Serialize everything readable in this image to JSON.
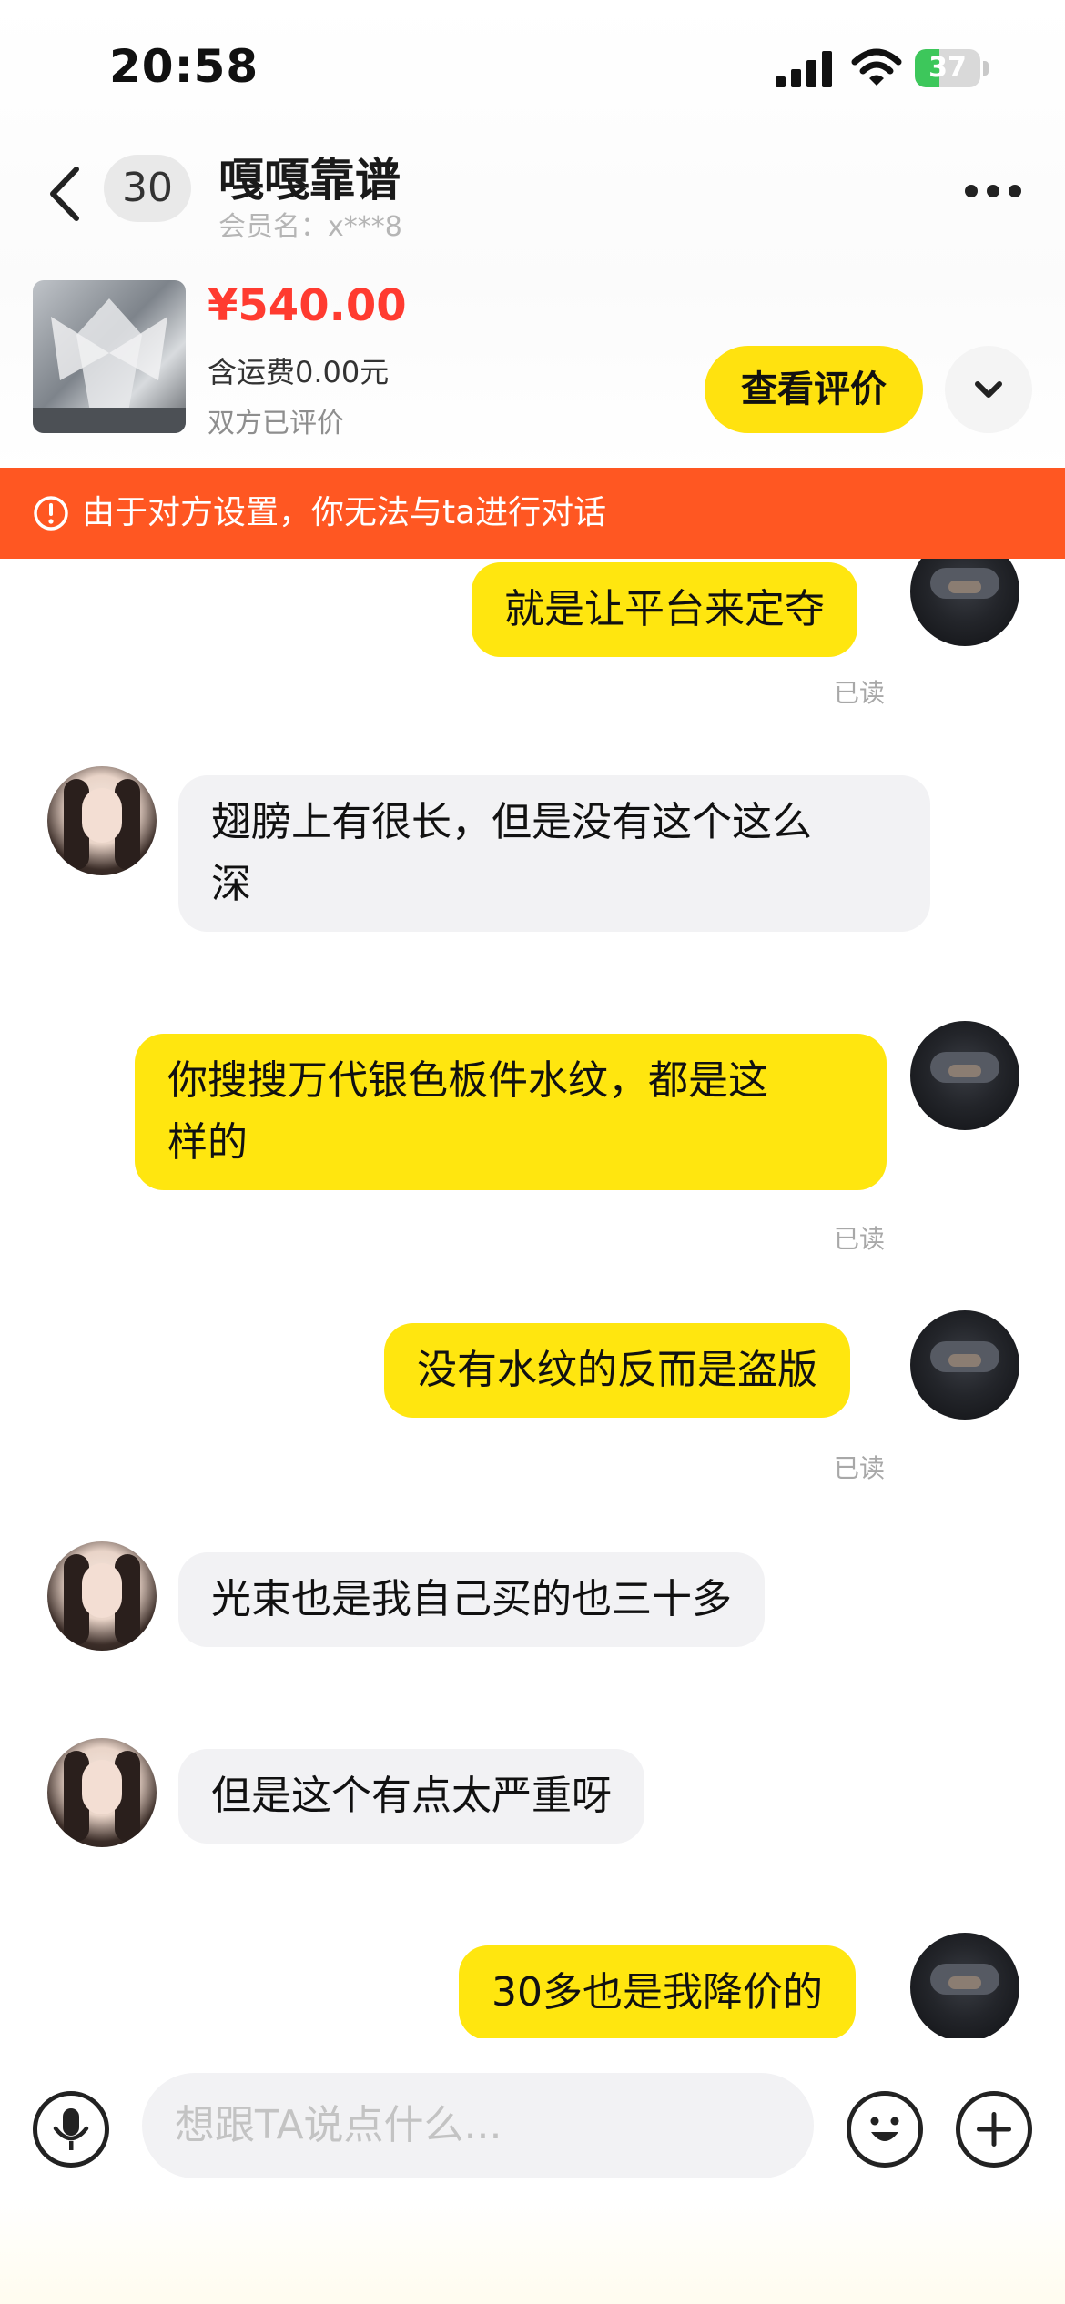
{
  "status_bar": {
    "time": "20:58",
    "battery": "37"
  },
  "header": {
    "unread_count": "30",
    "title": "嘎嘎靠谱",
    "member_name": "会员名：x***8"
  },
  "product": {
    "price": "¥540.00",
    "shipping": "含运费0.00元",
    "status": "双方已评价",
    "review_button": "查看评价"
  },
  "warning": {
    "text": "由于对方设置，你无法与ta进行对话"
  },
  "messages": [
    {
      "sender": "me",
      "text": "就是让平台来定夺",
      "read": "已读"
    },
    {
      "sender": "other",
      "text": "翅膀上有很长，但是没有这个这么\n深"
    },
    {
      "sender": "me",
      "text": "你搜搜万代银色板件水纹，都是这\n样的",
      "read": "已读"
    },
    {
      "sender": "me",
      "text": "没有水纹的反而是盗版",
      "read": "已读"
    },
    {
      "sender": "other",
      "text": "光束也是我自己买的也三十多"
    },
    {
      "sender": "other",
      "text": "但是这个有点太严重呀"
    },
    {
      "sender": "me",
      "text": "30多也是我降价的"
    }
  ],
  "input": {
    "placeholder": "想跟TA说点什么..."
  },
  "colors": {
    "accent_yellow": "#ffe60f",
    "warning_orange": "#ff5722",
    "price_red": "#ff3b30"
  },
  "icons": [
    "back-icon",
    "more-icon",
    "chevron-down-icon",
    "warning-icon",
    "mic-icon",
    "emoji-icon",
    "plus-icon"
  ]
}
